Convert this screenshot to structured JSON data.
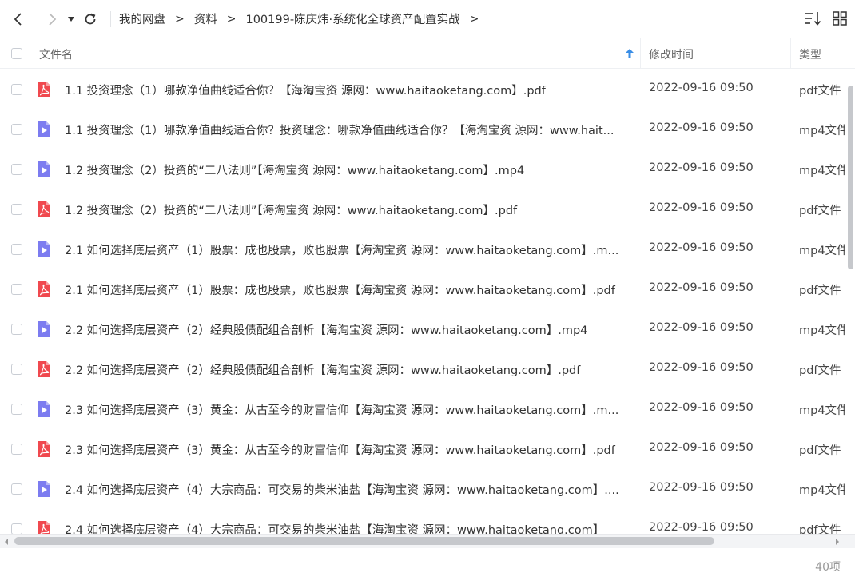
{
  "toolbar": {
    "breadcrumbs": [
      {
        "label": "我的网盘"
      },
      {
        "label": "资料"
      },
      {
        "label": "100199-陈庆炜·系统化全球资产配置实战"
      }
    ],
    "crumb_separator": ">"
  },
  "header": {
    "name": "文件名",
    "modified": "修改时间",
    "type": "类型"
  },
  "files": [
    {
      "kind": "pdf",
      "name": "1.1 投资理念（1）哪款净值曲线适合你？【海淘宝资 源网：www.haitaoketang.com】.pdf",
      "time": "2022-09-16 09:50",
      "type": "pdf文件"
    },
    {
      "kind": "mp4",
      "name": "1.1 投资理念（1）哪款净值曲线适合你？投资理念：哪款净值曲线适合你？【海淘宝资 源网：www.hait...",
      "time": "2022-09-16 09:50",
      "type": "mp4文件"
    },
    {
      "kind": "mp4",
      "name": "1.2 投资理念（2）投资的“二八法则”【海淘宝资 源网：www.haitaoketang.com】.mp4",
      "time": "2022-09-16 09:50",
      "type": "mp4文件"
    },
    {
      "kind": "pdf",
      "name": "1.2 投资理念（2）投资的“二八法则”【海淘宝资 源网：www.haitaoketang.com】.pdf",
      "time": "2022-09-16 09:50",
      "type": "pdf文件"
    },
    {
      "kind": "mp4",
      "name": "2.1 如何选择底层资产（1）股票：成也股票，败也股票【海淘宝资 源网：www.haitaoketang.com】.m...",
      "time": "2022-09-16 09:50",
      "type": "mp4文件"
    },
    {
      "kind": "pdf",
      "name": "2.1 如何选择底层资产（1）股票：成也股票，败也股票【海淘宝资 源网：www.haitaoketang.com】.pdf",
      "time": "2022-09-16 09:50",
      "type": "pdf文件"
    },
    {
      "kind": "mp4",
      "name": "2.2 如何选择底层资产（2）经典股债配组合剖析【海淘宝资 源网：www.haitaoketang.com】.mp4",
      "time": "2022-09-16 09:50",
      "type": "mp4文件"
    },
    {
      "kind": "pdf",
      "name": "2.2 如何选择底层资产（2）经典股债配组合剖析【海淘宝资 源网：www.haitaoketang.com】.pdf",
      "time": "2022-09-16 09:50",
      "type": "pdf文件"
    },
    {
      "kind": "mp4",
      "name": "2.3 如何选择底层资产（3）黄金：从古至今的财富信仰【海淘宝资 源网：www.haitaoketang.com】.m...",
      "time": "2022-09-16 09:50",
      "type": "mp4文件"
    },
    {
      "kind": "pdf",
      "name": "2.3 如何选择底层资产（3）黄金：从古至今的财富信仰【海淘宝资 源网：www.haitaoketang.com】.pdf",
      "time": "2022-09-16 09:50",
      "type": "pdf文件"
    },
    {
      "kind": "mp4",
      "name": "2.4 如何选择底层资产（4）大宗商品：可交易的柴米油盐【海淘宝资 源网：www.haitaoketang.com】....",
      "time": "2022-09-16 09:50",
      "type": "mp4文件"
    },
    {
      "kind": "pdf",
      "name": "2.4 如何选择底层资产（4）大宗商品：可交易的柴米油盐【海淘宝资 源网：www.haitaoketang.com】",
      "time": "2022-09-16 09:50",
      "type": "pdf文件"
    }
  ],
  "footer": {
    "count": "40项"
  },
  "icons": {
    "pdf": "pdf-file-icon",
    "mp4": "video-file-icon"
  },
  "colors": {
    "pdf": "#f0494f",
    "mp4": "#7c7cf0",
    "scroll_thumb": "#c6c8cc"
  }
}
